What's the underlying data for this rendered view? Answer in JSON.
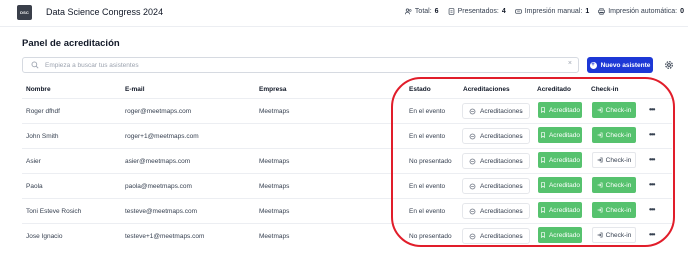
{
  "app": {
    "logo_text": "DSC",
    "title": "Data Science Congress 2024"
  },
  "stats": [
    {
      "icon": "users-icon",
      "label": "Total:",
      "value": "6"
    },
    {
      "icon": "id-card-icon",
      "label": "Presentados:",
      "value": "4"
    },
    {
      "icon": "ticket-icon",
      "label": "Impresión manual:",
      "value": "1"
    },
    {
      "icon": "printer-icon",
      "label": "Impresión automática:",
      "value": "0"
    }
  ],
  "panel": {
    "title": "Panel de acreditación",
    "search_placeholder": "Empieza a buscar tus asistentes",
    "clear": "×",
    "new_button": "Nuevo asistente",
    "plus": "+"
  },
  "table": {
    "headers": [
      "Nombre",
      "E-mail",
      "Empresa",
      "Estado",
      "Acreditaciones",
      "Acreditado",
      "Check-in"
    ],
    "select_label": "Acreditaciones",
    "acc_label": "Acreditado",
    "checkin_label": "Check-in",
    "more": "•••",
    "rows": [
      {
        "name": "Roger dfhdf",
        "email": "roger@meetmaps.com",
        "company": "Meetmaps",
        "status": "En el evento",
        "accredited": true,
        "checked_in": true
      },
      {
        "name": "John Smith",
        "email": "roger+1@meetmaps.com",
        "company": "",
        "status": "En el evento",
        "accredited": true,
        "checked_in": true
      },
      {
        "name": "Asier",
        "email": "asier@meetmaps.com",
        "company": "Meetmaps",
        "status": "No presentado",
        "accredited": true,
        "checked_in": false
      },
      {
        "name": "Paola",
        "email": "paola@meetmaps.com",
        "company": "Meetmaps",
        "status": "En el evento",
        "accredited": true,
        "checked_in": true
      },
      {
        "name": "Toni Esteve Rosich",
        "email": "testeve@meetmaps.com",
        "company": "Meetmaps",
        "status": "En el evento",
        "accredited": true,
        "checked_in": true
      },
      {
        "name": "Jose Ignacio",
        "email": "testeve+1@meetmaps.com",
        "company": "Meetmaps",
        "status": "No presentado",
        "accredited": true,
        "checked_in": false
      }
    ]
  },
  "colors": {
    "accent": "#1d38d6",
    "success": "#56c26e",
    "annotation": "#e11d2a"
  }
}
